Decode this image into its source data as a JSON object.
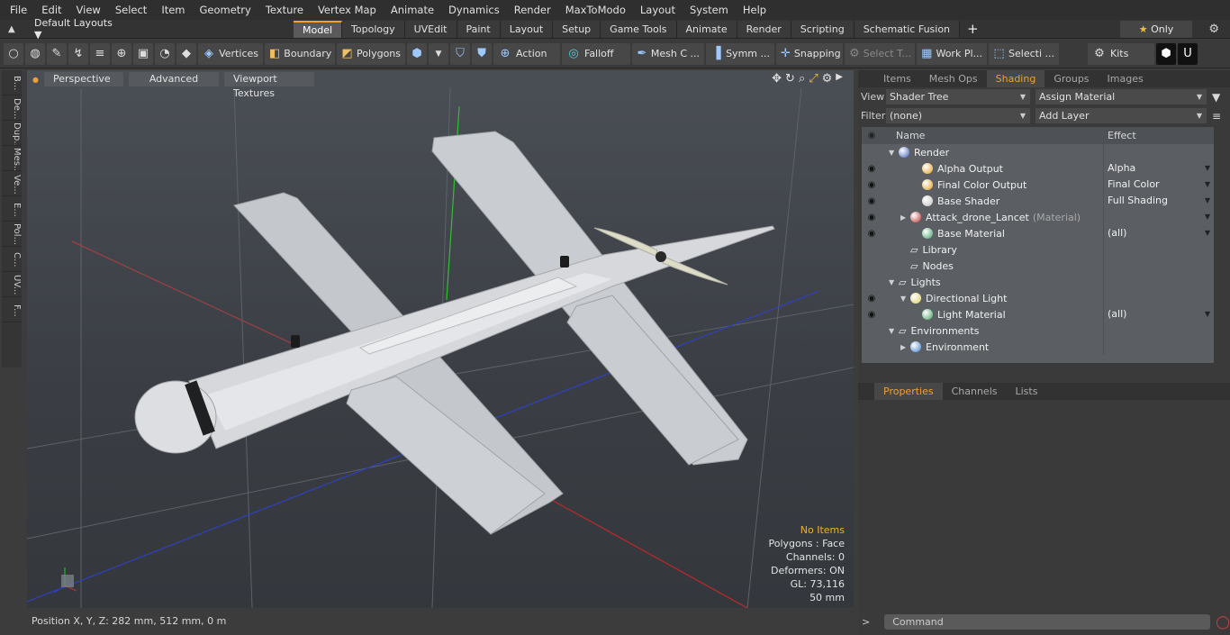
{
  "menu": [
    "File",
    "Edit",
    "View",
    "Select",
    "Item",
    "Geometry",
    "Texture",
    "Vertex Map",
    "Animate",
    "Dynamics",
    "Render",
    "MaxToModo",
    "Layout",
    "System",
    "Help"
  ],
  "layout_dropdown": "Default Layouts",
  "layout_tabs": [
    "Model",
    "Topology",
    "UVEdit",
    "Paint",
    "Layout",
    "Setup",
    "Game Tools",
    "Animate",
    "Render",
    "Scripting",
    "Schematic Fusion"
  ],
  "active_layout_tab": "Model",
  "only_label": "Only",
  "toolbar": {
    "vertices": "Vertices",
    "boundary": "Boundary",
    "polygons": "Polygons",
    "action": "Action",
    "falloff": "Falloff",
    "mesh": "Mesh C ...",
    "symm": "Symm ...",
    "snapping": "Snapping",
    "select_t": "Select T...",
    "work_pl": "Work Pl...",
    "selecti": "Selecti ...",
    "kits": "Kits"
  },
  "left_tabs": [
    "B...",
    "De...",
    "Dup...",
    "Mes...",
    "Ve...",
    "E...",
    "Pol...",
    "C...",
    "UV...",
    "F..."
  ],
  "viewport": {
    "perspective": "Perspective",
    "advanced": "Advanced",
    "textures": "Viewport Textures",
    "info": {
      "no_items": "No Items",
      "polygons": "Polygons : Face",
      "channels": "Channels: 0",
      "deformers": "Deformers: ON",
      "gl": "GL: 73,116",
      "scale": "50 mm"
    }
  },
  "status": "Position X, Y, Z:   282 mm, 512 mm, 0 m",
  "panel": {
    "tabs": [
      "Items",
      "Mesh Ops",
      "Shading",
      "Groups",
      "Images"
    ],
    "active_tab": "Shading",
    "view_label": "View",
    "view_value": "Shader Tree",
    "assign": "Assign Material",
    "filter_label": "Filter",
    "filter_value": "(none)",
    "add_layer": "Add Layer",
    "col_name": "Name",
    "col_effect": "Effect",
    "rows": [
      {
        "name": "Render",
        "effect": "",
        "indent": 0,
        "eye": false,
        "arrow": "▼",
        "color": "#4060c0",
        "sub": "",
        "dd": false
      },
      {
        "name": "Alpha Output",
        "effect": "Alpha",
        "indent": 2,
        "eye": true,
        "arrow": "",
        "color": "#e0a020",
        "sub": "",
        "dd": true
      },
      {
        "name": "Final Color Output",
        "effect": "Final Color",
        "indent": 2,
        "eye": true,
        "arrow": "",
        "color": "#e0a020",
        "sub": "",
        "dd": true
      },
      {
        "name": "Base Shader",
        "effect": "Full Shading",
        "indent": 2,
        "eye": true,
        "arrow": "",
        "color": "#c0c0c0",
        "sub": "",
        "dd": true
      },
      {
        "name": "Attack_drone_Lancet",
        "effect": "",
        "indent": 1,
        "eye": true,
        "arrow": "▶",
        "color": "#c03030",
        "sub": "(Material)",
        "dd": true
      },
      {
        "name": "Base Material",
        "effect": "(all)",
        "indent": 2,
        "eye": true,
        "arrow": "",
        "color": "#40a060",
        "sub": "",
        "dd": true
      },
      {
        "name": "Library",
        "effect": "",
        "indent": 1,
        "eye": false,
        "arrow": "",
        "color": "",
        "sub": "",
        "dd": false
      },
      {
        "name": "Nodes",
        "effect": "",
        "indent": 1,
        "eye": false,
        "arrow": "",
        "color": "",
        "sub": "",
        "dd": false
      },
      {
        "name": "Lights",
        "effect": "",
        "indent": 0,
        "eye": false,
        "arrow": "▼",
        "color": "",
        "sub": "",
        "dd": false
      },
      {
        "name": "Directional Light",
        "effect": "",
        "indent": 1,
        "eye": true,
        "arrow": "▼",
        "color": "#e0d060",
        "sub": "",
        "dd": false
      },
      {
        "name": "Light Material",
        "effect": "(all)",
        "indent": 2,
        "eye": true,
        "arrow": "",
        "color": "#40a060",
        "sub": "",
        "dd": true
      },
      {
        "name": "Environments",
        "effect": "",
        "indent": 0,
        "eye": false,
        "arrow": "▼",
        "color": "",
        "sub": "",
        "dd": false
      },
      {
        "name": "Environment",
        "effect": "",
        "indent": 1,
        "eye": false,
        "arrow": "▶",
        "color": "#4080d0",
        "sub": "",
        "dd": false
      }
    ],
    "prop_tabs": [
      "Properties",
      "Channels",
      "Lists"
    ],
    "active_prop_tab": "Properties",
    "command_placeholder": "Command"
  }
}
